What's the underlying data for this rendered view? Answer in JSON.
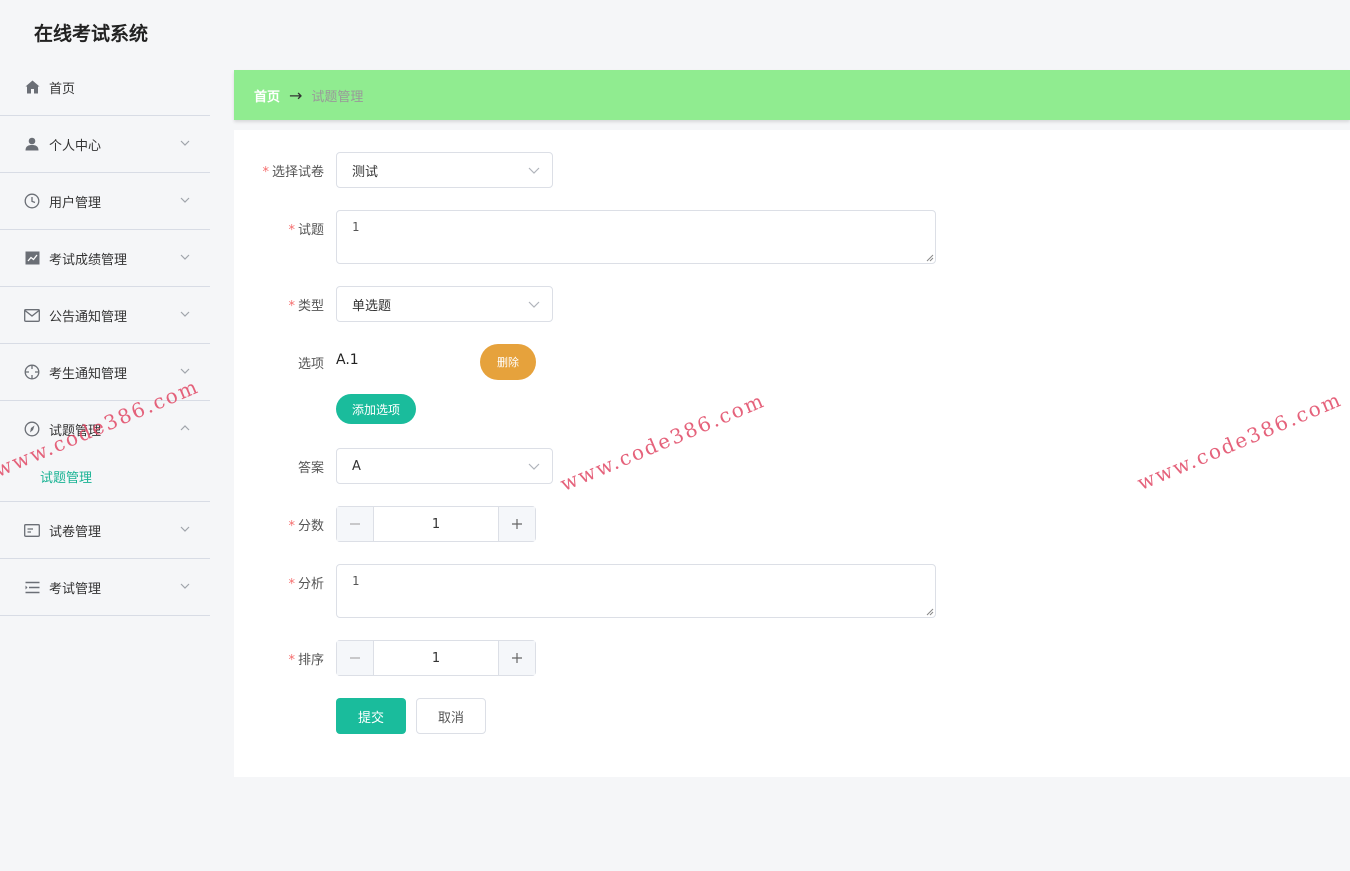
{
  "app": {
    "title": "在线考试系统"
  },
  "sidebar": {
    "items": [
      {
        "label": "首页",
        "icon": "home-icon"
      },
      {
        "label": "个人中心",
        "icon": "user-icon"
      },
      {
        "label": "用户管理",
        "icon": "clock-icon"
      },
      {
        "label": "考试成绩管理",
        "icon": "chart-icon"
      },
      {
        "label": "公告通知管理",
        "icon": "mail-icon"
      },
      {
        "label": "考生通知管理",
        "icon": "target-icon"
      },
      {
        "label": "试题管理",
        "icon": "compass-icon",
        "sub": "试题管理"
      },
      {
        "label": "试卷管理",
        "icon": "card-icon"
      },
      {
        "label": "考试管理",
        "icon": "list-icon"
      }
    ]
  },
  "breadcrumb": {
    "home": "首页",
    "separator": "→",
    "current": "试题管理"
  },
  "form": {
    "paper": {
      "label": "选择试卷",
      "value": "测试"
    },
    "question": {
      "label": "试题",
      "value": "1"
    },
    "type": {
      "label": "类型",
      "value": "单选题"
    },
    "options": {
      "label": "选项",
      "items": [
        "A.1"
      ],
      "delete_label": "删除",
      "add_label": "添加选项"
    },
    "answer": {
      "label": "答案",
      "value": "A"
    },
    "score": {
      "label": "分数",
      "value": "1"
    },
    "analysis": {
      "label": "分析",
      "value": "1"
    },
    "order": {
      "label": "排序",
      "value": "1"
    },
    "submit_label": "提交",
    "cancel_label": "取消"
  },
  "watermark": "www.code386.com",
  "colors": {
    "accent": "#1abc9c",
    "breadcrumb_bg": "#90ec90",
    "delete": "#e6a23c",
    "required": "#f56c6c"
  }
}
